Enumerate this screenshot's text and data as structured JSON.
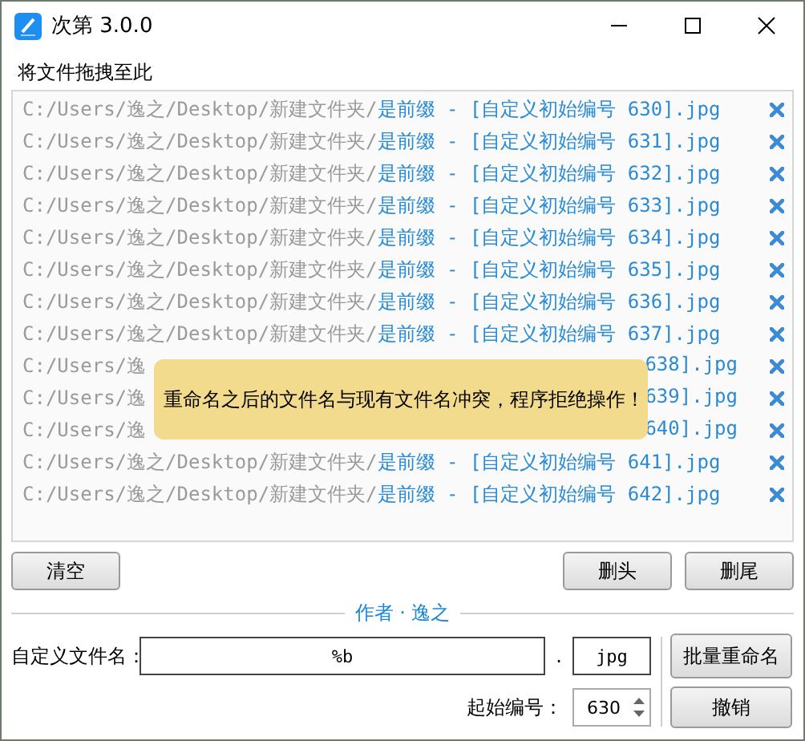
{
  "window": {
    "title": "次第 3.0.0"
  },
  "drop_label": "将文件拖拽至此",
  "files": [
    {
      "kind": "full",
      "path": "C:/Users/逸之/Desktop/新建文件夹/",
      "name": "是前缀 - [自定义初始编号 630].jpg"
    },
    {
      "kind": "full",
      "path": "C:/Users/逸之/Desktop/新建文件夹/",
      "name": "是前缀 - [自定义初始编号 631].jpg"
    },
    {
      "kind": "full",
      "path": "C:/Users/逸之/Desktop/新建文件夹/",
      "name": "是前缀 - [自定义初始编号 632].jpg"
    },
    {
      "kind": "full",
      "path": "C:/Users/逸之/Desktop/新建文件夹/",
      "name": "是前缀 - [自定义初始编号 633].jpg"
    },
    {
      "kind": "full",
      "path": "C:/Users/逸之/Desktop/新建文件夹/",
      "name": "是前缀 - [自定义初始编号 634].jpg"
    },
    {
      "kind": "full",
      "path": "C:/Users/逸之/Desktop/新建文件夹/",
      "name": "是前缀 - [自定义初始编号 635].jpg"
    },
    {
      "kind": "full",
      "path": "C:/Users/逸之/Desktop/新建文件夹/",
      "name": "是前缀 - [自定义初始编号 636].jpg"
    },
    {
      "kind": "full",
      "path": "C:/Users/逸之/Desktop/新建文件夹/",
      "name": "是前缀 - [自定义初始编号 637].jpg"
    },
    {
      "kind": "covered",
      "path": "C:/Users/逸",
      "name": "638].jpg"
    },
    {
      "kind": "covered",
      "path": "C:/Users/逸",
      "name": "639].jpg"
    },
    {
      "kind": "covered",
      "path": "C:/Users/逸",
      "name": "640].jpg"
    },
    {
      "kind": "full",
      "path": "C:/Users/逸之/Desktop/新建文件夹/",
      "name": "是前缀 - [自定义初始编号 641].jpg"
    },
    {
      "kind": "full",
      "path": "C:/Users/逸之/Desktop/新建文件夹/",
      "name": "是前缀 - [自定义初始编号 642].jpg"
    }
  ],
  "toast": "重命名之后的文件名与现有文件名冲突，程序拒绝操作！",
  "list_buttons": {
    "left": [
      "清空"
    ],
    "right": [
      "删头",
      "删尾"
    ]
  },
  "author": "作者 · 逸之",
  "rename": {
    "label": "自定义文件名：",
    "value": "%b",
    "dot": ".",
    "extension": "jpg",
    "button": "批量重命名"
  },
  "start": {
    "label": "起始编号：",
    "value": "630",
    "button": "撤销"
  }
}
